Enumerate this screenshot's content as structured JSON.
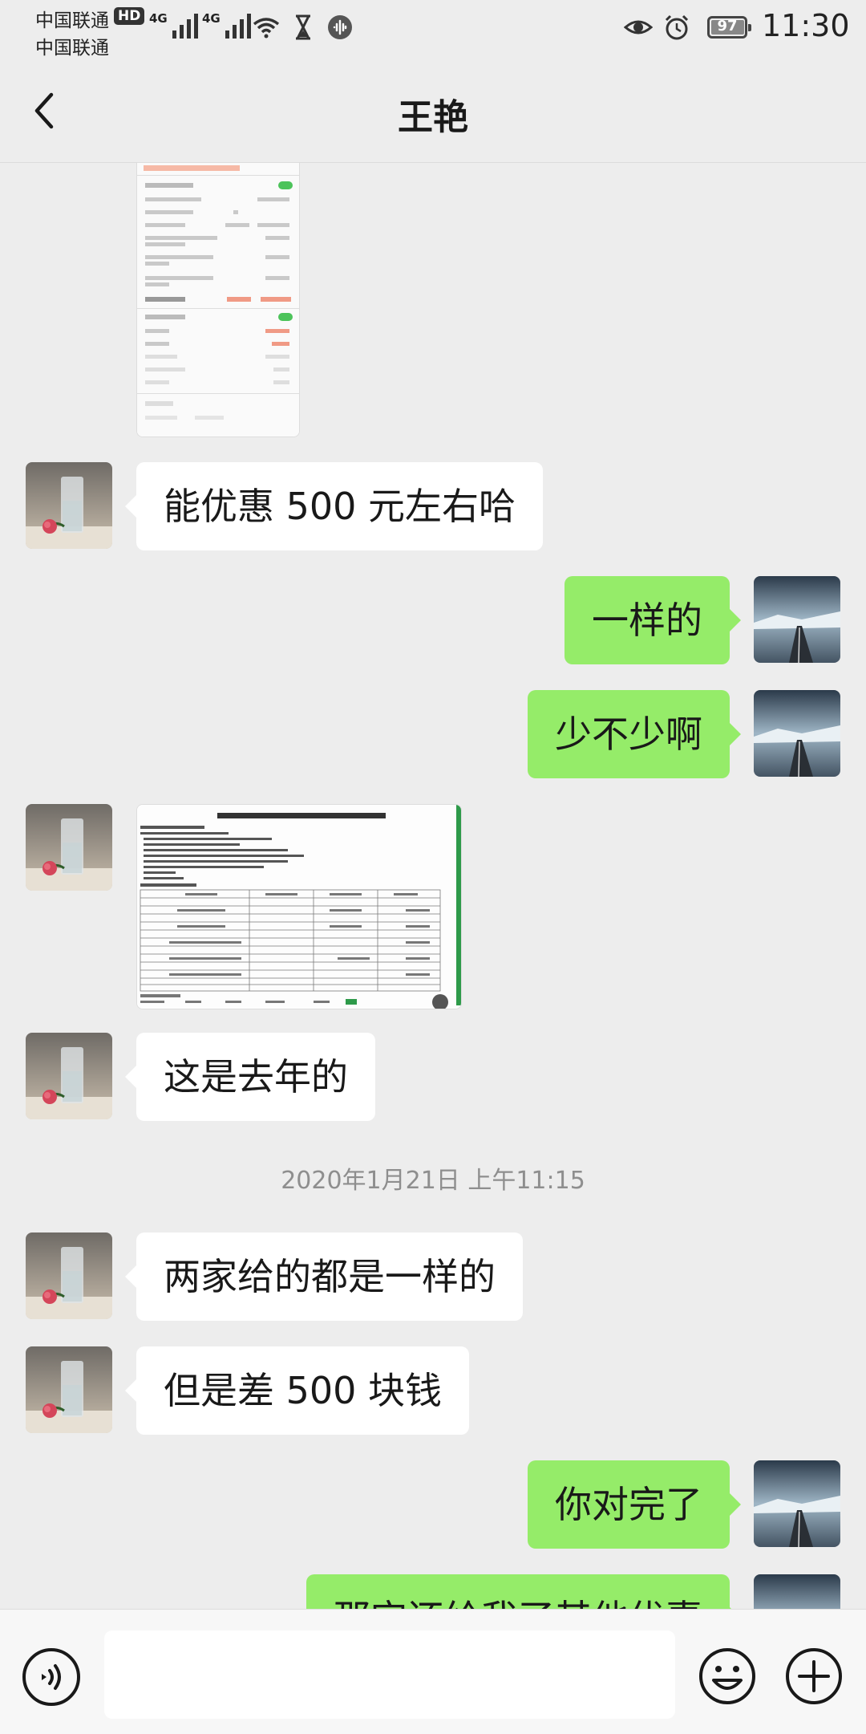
{
  "status": {
    "carrier1": "中国联通",
    "carrier2": "中国联通",
    "hd": "HD",
    "net1": "4G",
    "net2": "4G",
    "battery": "97",
    "time": "11:30"
  },
  "header": {
    "title": "王艳"
  },
  "messages": {
    "m1": "能优惠 500 元左右哈",
    "m2": "一样的",
    "m3": "少不少啊",
    "m4": "这是去年的",
    "ts": "2020年1月21日 上午11:15",
    "m5": "两家给的都是一样的",
    "m6": "但是差 500 块钱",
    "m7": "你对完了",
    "m8": "那宝还给我了其他优惠"
  },
  "input": {
    "placeholder": ""
  },
  "colors": {
    "sent": "#95ec69",
    "received": "#ffffff",
    "background": "#ededed"
  }
}
